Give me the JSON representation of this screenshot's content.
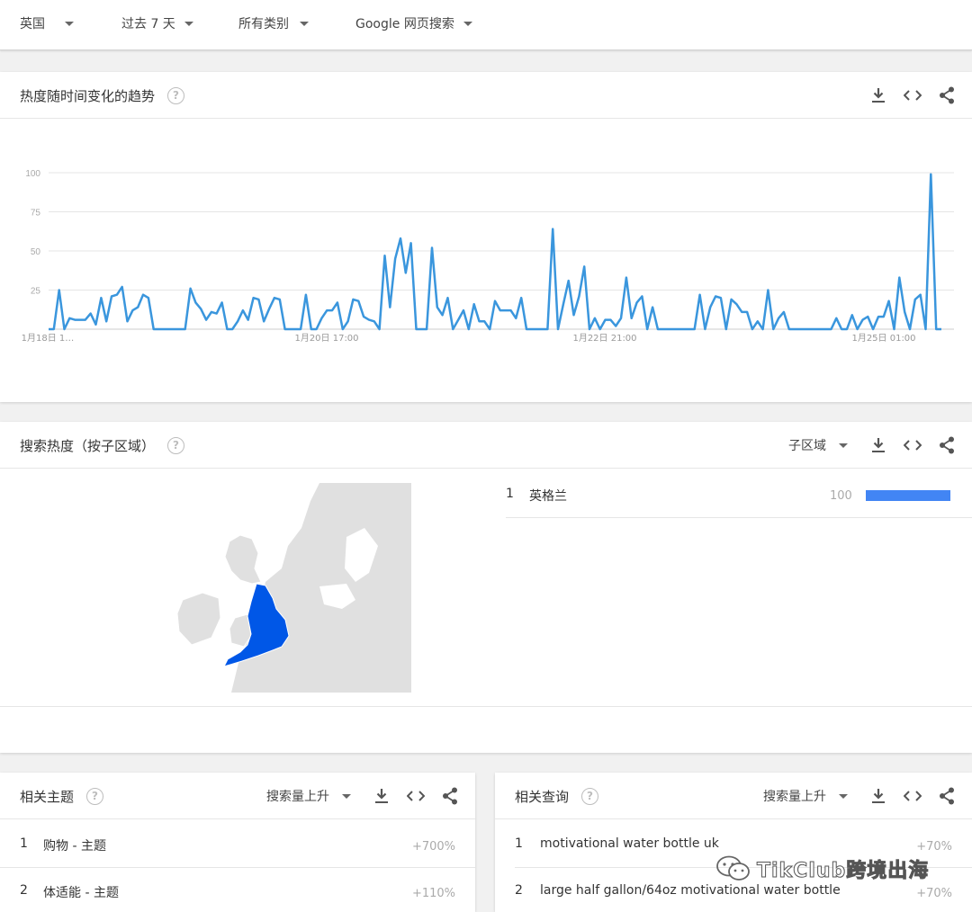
{
  "filters": {
    "region": "英国",
    "time": "过去 7 天",
    "category": "所有类别",
    "search_type": "Google 网页搜索"
  },
  "interest_over_time": {
    "title": "热度随时间变化的趋势",
    "help_glyph": "?"
  },
  "chart_data": {
    "type": "line",
    "x_tick_labels": [
      "1月18日 1…",
      "1月20日 17:00",
      "1月22日 21:00",
      "1月25日 01:00"
    ],
    "yticks": [
      25,
      50,
      75,
      100
    ],
    "ylim": [
      0,
      100
    ],
    "grid": true,
    "color": "#3a96dd",
    "values": [
      0,
      0,
      25,
      0,
      7,
      6,
      6,
      6,
      10,
      3,
      20,
      5,
      21,
      22,
      27,
      5,
      12,
      14,
      22,
      20,
      0,
      0,
      0,
      0,
      0,
      0,
      0,
      26,
      17,
      13,
      6,
      11,
      10,
      17,
      0,
      0,
      5,
      12,
      6,
      20,
      19,
      5,
      13,
      20,
      19,
      0,
      0,
      0,
      0,
      22,
      0,
      0,
      7,
      12,
      12,
      17,
      0,
      5,
      19,
      18,
      8,
      6,
      5,
      0,
      47,
      14,
      45,
      58,
      36,
      55,
      0,
      0,
      0,
      52,
      14,
      9,
      20,
      0,
      6,
      12,
      0,
      16,
      5,
      5,
      0,
      18,
      12,
      12,
      12,
      7,
      20,
      0,
      0,
      0,
      0,
      0,
      64,
      0,
      16,
      31,
      9,
      21,
      40,
      0,
      7,
      0,
      6,
      6,
      2,
      7,
      33,
      7,
      17,
      21,
      0,
      14,
      0,
      0,
      0,
      0,
      0,
      0,
      0,
      0,
      22,
      0,
      14,
      21,
      20,
      0,
      19,
      16,
      11,
      11,
      0,
      5,
      0,
      25,
      0,
      7,
      11,
      0,
      0,
      0,
      0,
      0,
      0,
      0,
      0,
      0,
      7,
      0,
      0,
      9,
      0,
      6,
      8,
      0,
      8,
      8,
      18,
      0,
      33,
      11,
      0,
      19,
      22,
      0,
      99,
      0,
      0
    ]
  },
  "subregion": {
    "title": "搜索热度（按子区域）",
    "help_glyph": "?",
    "select_label": "子区域",
    "regions": [
      {
        "rank": "1",
        "name": "英格兰",
        "value": "100",
        "fraction": 1.0
      }
    ],
    "map_colors": {
      "highlight": "#0057e7",
      "land": "#e0e0e0",
      "border": "#ffffff"
    }
  },
  "related_topics": {
    "title": "相关主题",
    "help_glyph": "?",
    "select_label": "搜索量上升",
    "rows": [
      {
        "rank": "1",
        "name": "购物 - 主题",
        "value": "+700%"
      },
      {
        "rank": "2",
        "name": "体适能 - 主题",
        "value": "+110%"
      }
    ]
  },
  "related_queries": {
    "title": "相关查询",
    "help_glyph": "?",
    "select_label": "搜索量上升",
    "rows": [
      {
        "rank": "1",
        "name": "motivational water bottle uk",
        "value": "+70%"
      },
      {
        "rank": "2",
        "name": "large half gallon/64oz motivational water bottle",
        "value": "+70%"
      }
    ]
  },
  "watermark": {
    "text": "TikClub跨境出海",
    "icon": "wechat-icon"
  },
  "icons": {
    "download": "download-icon",
    "embed": "code-icon",
    "share": "share-icon",
    "dropdown": "caret-down-icon"
  }
}
